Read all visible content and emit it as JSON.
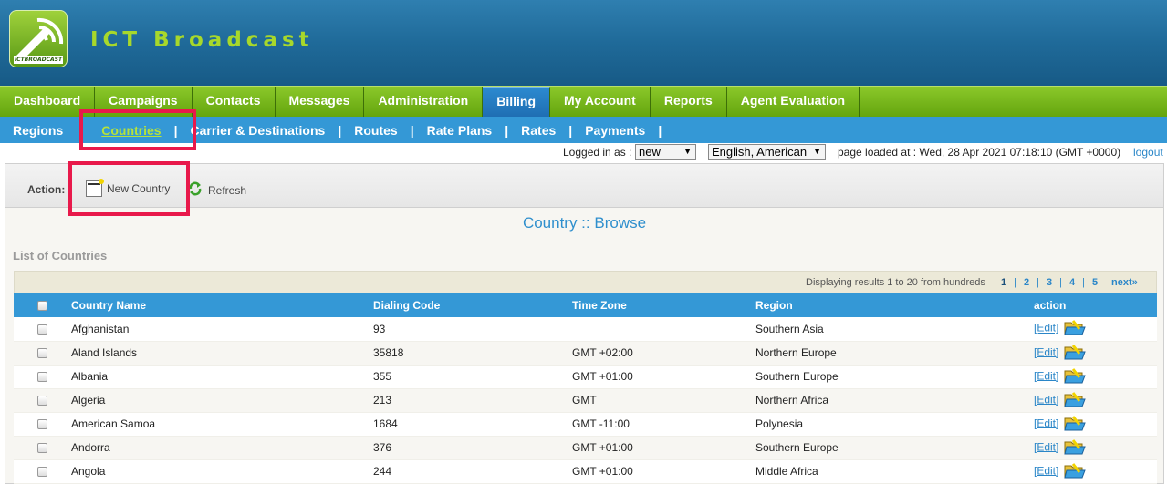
{
  "header": {
    "brand": "ICT Broadcast",
    "logo_text": "ICTBROADCAST"
  },
  "main_nav": [
    {
      "label": "Dashboard"
    },
    {
      "label": "Campaigns"
    },
    {
      "label": "Contacts"
    },
    {
      "label": "Messages"
    },
    {
      "label": "Administration"
    },
    {
      "label": "Billing"
    },
    {
      "label": "My Account"
    },
    {
      "label": "Reports"
    },
    {
      "label": "Agent Evaluation"
    }
  ],
  "sub_nav": [
    {
      "label": "Regions"
    },
    {
      "label": "Countries"
    },
    {
      "label": "Carrier & Destinations"
    },
    {
      "label": "Routes"
    },
    {
      "label": "Rate Plans"
    },
    {
      "label": "Rates"
    },
    {
      "label": "Payments"
    }
  ],
  "sub_nav_separator": "|",
  "status": {
    "logged_in_label": "Logged in as :",
    "user": "new",
    "language": "English, American",
    "page_loaded": "page loaded at : Wed, 28 Apr 2021 07:18:10 (GMT +0000)",
    "logout": "logout"
  },
  "action_bar": {
    "label": "Action:",
    "new_country": "New Country",
    "refresh": "Refresh"
  },
  "page_title": "Country :: Browse",
  "list_title": "List of Countries",
  "pager": {
    "display": "Displaying results 1 to 20 from hundreds",
    "pages": [
      "1",
      "2",
      "3",
      "4",
      "5"
    ],
    "next": "next»",
    "sep": "|"
  },
  "table": {
    "headers": {
      "name": "Country Name",
      "code": "Dialing Code",
      "tz": "Time Zone",
      "region": "Region",
      "action": "action"
    },
    "edit_label": "[Edit]",
    "rows": [
      {
        "name": "Afghanistan",
        "code": "93",
        "tz": "",
        "region": "Southern Asia"
      },
      {
        "name": "Aland Islands",
        "code": "35818",
        "tz": "GMT +02:00",
        "region": "Northern Europe"
      },
      {
        "name": "Albania",
        "code": "355",
        "tz": "GMT +01:00",
        "region": "Southern Europe"
      },
      {
        "name": "Algeria",
        "code": "213",
        "tz": "GMT",
        "region": "Northern Africa"
      },
      {
        "name": "American Samoa",
        "code": "1684",
        "tz": "GMT -11:00",
        "region": "Polynesia"
      },
      {
        "name": "Andorra",
        "code": "376",
        "tz": "GMT +01:00",
        "region": "Southern Europe"
      },
      {
        "name": "Angola",
        "code": "244",
        "tz": "GMT +01:00",
        "region": "Middle Africa"
      }
    ]
  },
  "colors": {
    "accent_green": "#8bc82a",
    "accent_blue": "#3498d6",
    "highlight": "#e8194b"
  }
}
